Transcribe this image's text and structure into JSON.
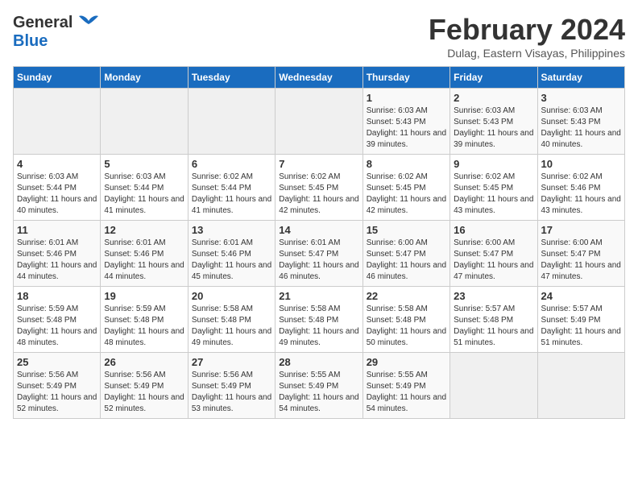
{
  "logo": {
    "general": "General",
    "blue": "Blue"
  },
  "title": "February 2024",
  "subtitle": "Dulag, Eastern Visayas, Philippines",
  "days_of_week": [
    "Sunday",
    "Monday",
    "Tuesday",
    "Wednesday",
    "Thursday",
    "Friday",
    "Saturday"
  ],
  "weeks": [
    [
      {
        "day": "",
        "info": ""
      },
      {
        "day": "",
        "info": ""
      },
      {
        "day": "",
        "info": ""
      },
      {
        "day": "",
        "info": ""
      },
      {
        "day": "1",
        "info": "Sunrise: 6:03 AM\nSunset: 5:43 PM\nDaylight: 11 hours and 39 minutes."
      },
      {
        "day": "2",
        "info": "Sunrise: 6:03 AM\nSunset: 5:43 PM\nDaylight: 11 hours and 39 minutes."
      },
      {
        "day": "3",
        "info": "Sunrise: 6:03 AM\nSunset: 5:43 PM\nDaylight: 11 hours and 40 minutes."
      }
    ],
    [
      {
        "day": "4",
        "info": "Sunrise: 6:03 AM\nSunset: 5:44 PM\nDaylight: 11 hours and 40 minutes."
      },
      {
        "day": "5",
        "info": "Sunrise: 6:03 AM\nSunset: 5:44 PM\nDaylight: 11 hours and 41 minutes."
      },
      {
        "day": "6",
        "info": "Sunrise: 6:02 AM\nSunset: 5:44 PM\nDaylight: 11 hours and 41 minutes."
      },
      {
        "day": "7",
        "info": "Sunrise: 6:02 AM\nSunset: 5:45 PM\nDaylight: 11 hours and 42 minutes."
      },
      {
        "day": "8",
        "info": "Sunrise: 6:02 AM\nSunset: 5:45 PM\nDaylight: 11 hours and 42 minutes."
      },
      {
        "day": "9",
        "info": "Sunrise: 6:02 AM\nSunset: 5:45 PM\nDaylight: 11 hours and 43 minutes."
      },
      {
        "day": "10",
        "info": "Sunrise: 6:02 AM\nSunset: 5:46 PM\nDaylight: 11 hours and 43 minutes."
      }
    ],
    [
      {
        "day": "11",
        "info": "Sunrise: 6:01 AM\nSunset: 5:46 PM\nDaylight: 11 hours and 44 minutes."
      },
      {
        "day": "12",
        "info": "Sunrise: 6:01 AM\nSunset: 5:46 PM\nDaylight: 11 hours and 44 minutes."
      },
      {
        "day": "13",
        "info": "Sunrise: 6:01 AM\nSunset: 5:46 PM\nDaylight: 11 hours and 45 minutes."
      },
      {
        "day": "14",
        "info": "Sunrise: 6:01 AM\nSunset: 5:47 PM\nDaylight: 11 hours and 46 minutes."
      },
      {
        "day": "15",
        "info": "Sunrise: 6:00 AM\nSunset: 5:47 PM\nDaylight: 11 hours and 46 minutes."
      },
      {
        "day": "16",
        "info": "Sunrise: 6:00 AM\nSunset: 5:47 PM\nDaylight: 11 hours and 47 minutes."
      },
      {
        "day": "17",
        "info": "Sunrise: 6:00 AM\nSunset: 5:47 PM\nDaylight: 11 hours and 47 minutes."
      }
    ],
    [
      {
        "day": "18",
        "info": "Sunrise: 5:59 AM\nSunset: 5:48 PM\nDaylight: 11 hours and 48 minutes."
      },
      {
        "day": "19",
        "info": "Sunrise: 5:59 AM\nSunset: 5:48 PM\nDaylight: 11 hours and 48 minutes."
      },
      {
        "day": "20",
        "info": "Sunrise: 5:58 AM\nSunset: 5:48 PM\nDaylight: 11 hours and 49 minutes."
      },
      {
        "day": "21",
        "info": "Sunrise: 5:58 AM\nSunset: 5:48 PM\nDaylight: 11 hours and 49 minutes."
      },
      {
        "day": "22",
        "info": "Sunrise: 5:58 AM\nSunset: 5:48 PM\nDaylight: 11 hours and 50 minutes."
      },
      {
        "day": "23",
        "info": "Sunrise: 5:57 AM\nSunset: 5:48 PM\nDaylight: 11 hours and 51 minutes."
      },
      {
        "day": "24",
        "info": "Sunrise: 5:57 AM\nSunset: 5:49 PM\nDaylight: 11 hours and 51 minutes."
      }
    ],
    [
      {
        "day": "25",
        "info": "Sunrise: 5:56 AM\nSunset: 5:49 PM\nDaylight: 11 hours and 52 minutes."
      },
      {
        "day": "26",
        "info": "Sunrise: 5:56 AM\nSunset: 5:49 PM\nDaylight: 11 hours and 52 minutes."
      },
      {
        "day": "27",
        "info": "Sunrise: 5:56 AM\nSunset: 5:49 PM\nDaylight: 11 hours and 53 minutes."
      },
      {
        "day": "28",
        "info": "Sunrise: 5:55 AM\nSunset: 5:49 PM\nDaylight: 11 hours and 54 minutes."
      },
      {
        "day": "29",
        "info": "Sunrise: 5:55 AM\nSunset: 5:49 PM\nDaylight: 11 hours and 54 minutes."
      },
      {
        "day": "",
        "info": ""
      },
      {
        "day": "",
        "info": ""
      }
    ]
  ]
}
